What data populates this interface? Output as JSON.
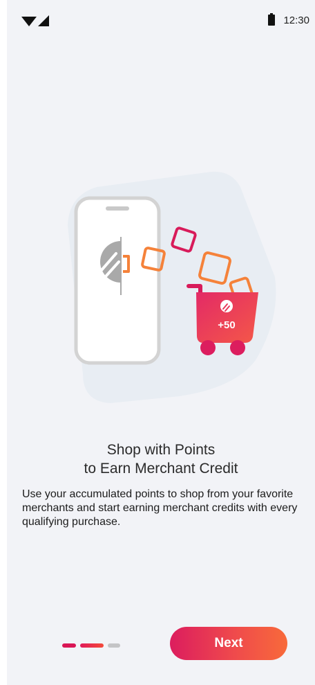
{
  "status_bar": {
    "time": "12:30",
    "icons": [
      "wifi-icon",
      "cellular-signal-icon",
      "battery-icon"
    ]
  },
  "illustration": {
    "cart_badge": "+50",
    "icons": [
      "phone-icon",
      "points-logo-icon",
      "shopping-cart-icon",
      "credit-square-icon"
    ],
    "colors": {
      "pink": "#dc1d5e",
      "orange": "#f5823a",
      "gray": "#aeaeae",
      "blob": "#e8edf3"
    }
  },
  "onboarding": {
    "title_line1": "Shop with Points",
    "title_line2": "to Earn Merchant Credit",
    "description": "Use your accumulated points to shop from your favorite merchants and start earning merchant credits with every qualifying purchase.",
    "page_indicator": {
      "total": 3,
      "current": 2
    },
    "next_label": "Next"
  },
  "colors": {
    "background": "#f2f3f7",
    "accent_start": "#dc1d5e",
    "accent_end": "#f86a3a",
    "inactive_dot": "#c4c4c6"
  }
}
